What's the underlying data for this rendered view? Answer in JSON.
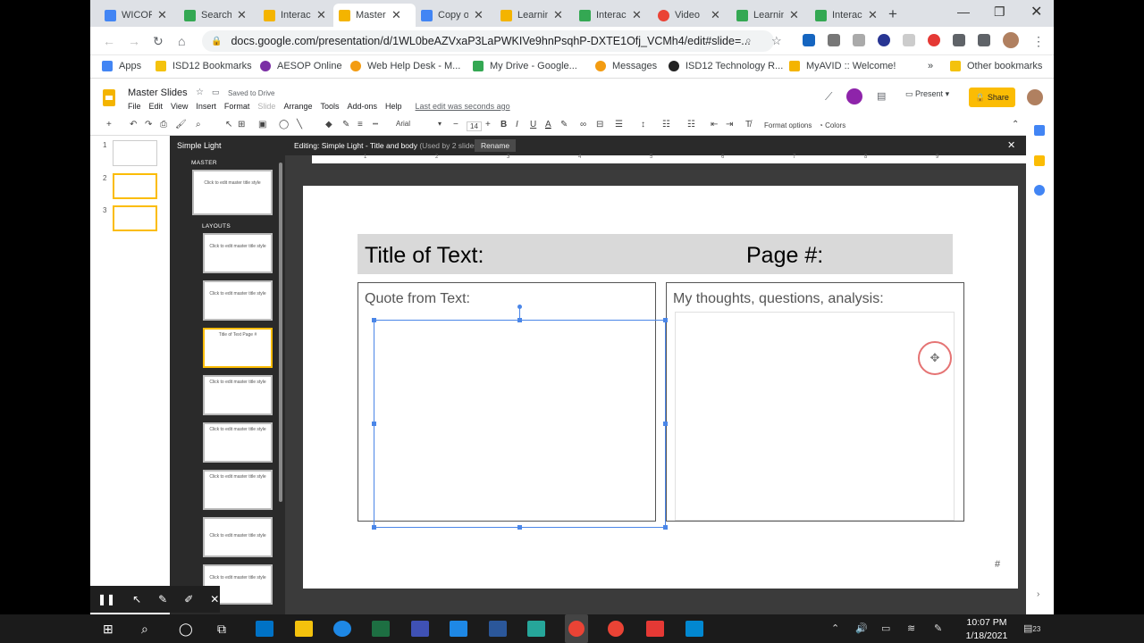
{
  "browser": {
    "tabs": [
      {
        "title": "WICOR",
        "icon_color": "#4285f4"
      },
      {
        "title": "Search",
        "icon_color": "#34a853"
      },
      {
        "title": "Interac",
        "icon_color": "#f4b400"
      },
      {
        "title": "Master",
        "icon_color": "#f4b400"
      },
      {
        "title": "Copy o",
        "icon_color": "#4285f4"
      },
      {
        "title": "Learnin",
        "icon_color": "#f4b400"
      },
      {
        "title": "Interac",
        "icon_color": "#34a853"
      },
      {
        "title": "Video",
        "icon_color": "#ea4335"
      },
      {
        "title": "Learnin",
        "icon_color": "#34a853"
      },
      {
        "title": "Interac",
        "icon_color": "#34a853"
      }
    ],
    "active_tab": 3,
    "url": "docs.google.com/presentation/d/1WL0beAZVxaP3LaPWKIVe9hnPsqhP-DXTE1Ofj_VCMh4/edit#slide=...",
    "bookmarks": [
      {
        "label": "Apps",
        "icon_color": "#4285f4"
      },
      {
        "label": "ISD12 Bookmarks",
        "icon_color": "#f4c20d"
      },
      {
        "label": "AESOP Online",
        "icon_color": "#7b2fa5"
      },
      {
        "label": "Web Help Desk - M...",
        "icon_color": "#f39c12"
      },
      {
        "label": "My Drive - Google...",
        "icon_color": "#34a853"
      },
      {
        "label": "Messages",
        "icon_color": "#f39c12"
      },
      {
        "label": "ISD12 Technology R...",
        "icon_color": "#222222"
      },
      {
        "label": "MyAVID :: Welcome!",
        "icon_color": "#f4b400"
      }
    ],
    "other_bookmarks": "Other bookmarks"
  },
  "doc": {
    "title": "Master Slides",
    "saved": "Saved to Drive",
    "menus": [
      "File",
      "Edit",
      "View",
      "Insert",
      "Format",
      "Slide",
      "Arrange",
      "Tools",
      "Add-ons",
      "Help"
    ],
    "last_edit": "Last edit was seconds ago",
    "present": "Present",
    "share": "Share"
  },
  "toolbar": {
    "font": "Arial",
    "font_size": "14",
    "format_options": "Format options",
    "colors": "Colors"
  },
  "filmstrip": {
    "numbers": [
      "1",
      "2",
      "3"
    ]
  },
  "master_panel": {
    "title": "Simple Light",
    "master_label": "MASTER",
    "layouts_label": "LAYOUTS",
    "master_thumb_text": "Click to edit master title style",
    "layout_thumbs": [
      "Click to edit master title style",
      "Click to edit master title style",
      "Title of Text   Page #",
      "Click to edit master title style",
      "Click to edit master title style",
      "Click to edit master title style",
      "Click to edit master title style",
      "Click to edit master title style"
    ]
  },
  "editor": {
    "editing_label": "Editing: Simple Light - Title and body",
    "used_by": "(Used by 2 slides)",
    "rename": "Rename",
    "ruler_marks": [
      "1",
      "2",
      "3",
      "4",
      "5",
      "6",
      "7",
      "8",
      "9"
    ]
  },
  "slide": {
    "title_text": "Title of Text:",
    "page_text": "Page #:",
    "quote_label": "Quote from Text:",
    "thoughts_label": "My thoughts, questions, analysis:",
    "slide_number": "#"
  },
  "taskbar": {
    "time": "10:07 PM",
    "date": "1/18/2021",
    "notifications": "23"
  }
}
